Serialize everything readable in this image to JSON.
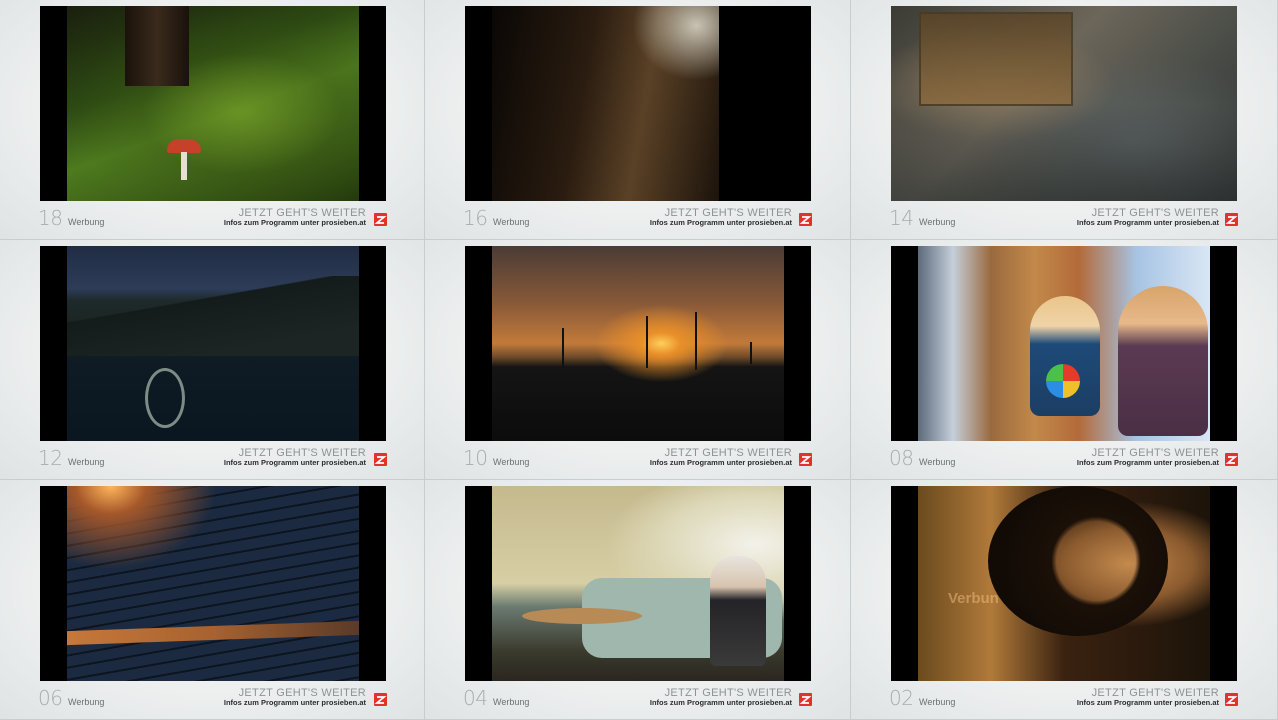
{
  "panels": [
    {
      "countdown": "18",
      "label": "Werbung",
      "headline": "JETZT GEHT'S WEITER",
      "info": "Infos zum Programm unter prosieben.at",
      "scene": "forest-mushroom"
    },
    {
      "countdown": "16",
      "label": "Werbung",
      "headline": "JETZT GEHT'S WEITER",
      "info": "Infos zum Programm unter prosieben.at",
      "scene": "hair-closeup"
    },
    {
      "countdown": "14",
      "label": "Werbung",
      "headline": "JETZT GEHT'S WEITER",
      "info": "Infos zum Programm unter prosieben.at",
      "scene": "collage"
    },
    {
      "countdown": "12",
      "label": "Werbung",
      "headline": "JETZT GEHT'S WEITER",
      "info": "Infos zum Programm unter prosieben.at",
      "scene": "mountain-lake"
    },
    {
      "countdown": "10",
      "label": "Werbung",
      "headline": "JETZT GEHT'S WEITER",
      "info": "Infos zum Programm unter prosieben.at",
      "scene": "wind-turbines-sunset"
    },
    {
      "countdown": "08",
      "label": "Werbung",
      "headline": "JETZT GEHT'S WEITER",
      "info": "Infos zum Programm unter prosieben.at",
      "scene": "children-scooter"
    },
    {
      "countdown": "06",
      "label": "Werbung",
      "headline": "JETZT GEHT'S WEITER",
      "info": "Infos zum Programm unter prosieben.at",
      "scene": "solar-panels"
    },
    {
      "countdown": "04",
      "label": "Werbung",
      "headline": "JETZT GEHT'S WEITER",
      "info": "Infos zum Programm unter prosieben.at",
      "scene": "living-room"
    },
    {
      "countdown": "02",
      "label": "Werbung",
      "headline": "JETZT GEHT'S WEITER",
      "info": "Infos zum Programm unter prosieben.at",
      "scene": "portrait",
      "overlay_text": "Verbun"
    }
  ],
  "brand": {
    "logo_icon": "prosieben-logo-icon",
    "logo_color": "#e4312a"
  },
  "colors": {
    "background": "#eef0f0",
    "countdown": "#a7acae",
    "headline": "#8e9396",
    "info": "#2b2e30"
  }
}
